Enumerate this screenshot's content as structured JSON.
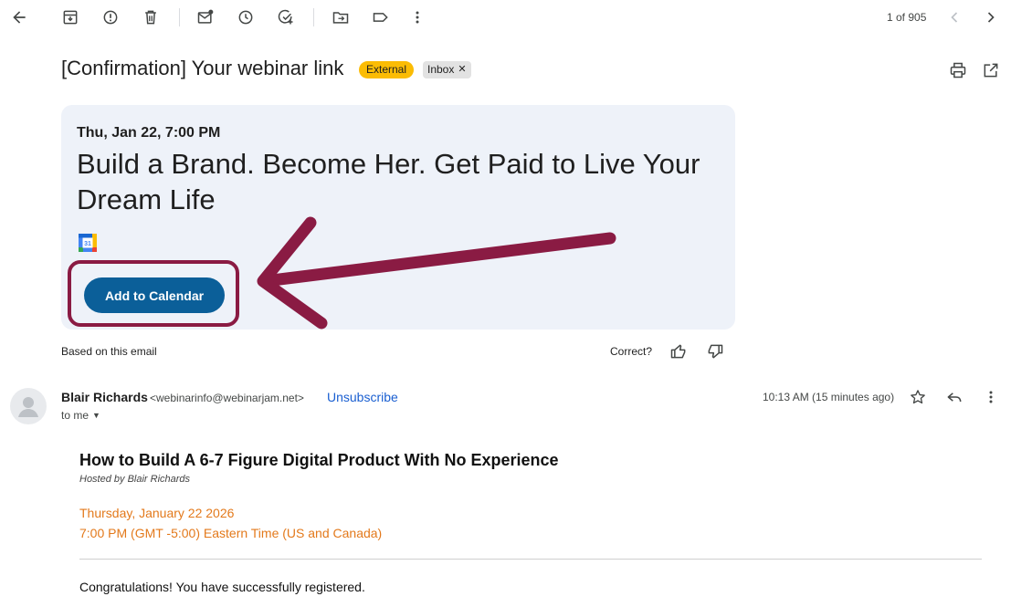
{
  "toolbar": {
    "icons": [
      "back-arrow-icon",
      "archive-icon",
      "report-spam-icon",
      "delete-icon",
      "mark-unread-icon",
      "snooze-icon",
      "add-to-tasks-icon",
      "move-to-icon",
      "label-icon",
      "more-vert-icon"
    ],
    "pagination": "1 of 905"
  },
  "email": {
    "subject": "[Confirmation] Your webinar link",
    "badges": {
      "external": "External",
      "inbox": "Inbox"
    }
  },
  "event_card": {
    "date": "Thu, Jan 22, 7:00 PM",
    "title": "Build a Brand. Become Her. Get Paid to Live Your Dream Life",
    "calendar_icon_label": "31",
    "add_button": "Add to Calendar",
    "based_on": "Based on this email",
    "correct_prompt": "Correct?"
  },
  "message": {
    "sender_name": "Blair Richards",
    "sender_email": "<webinarinfo@webinarjam.net>",
    "unsubscribe": "Unsubscribe",
    "to": "to me",
    "timestamp": "10:13 AM (15 minutes ago)"
  },
  "body": {
    "heading": "How to Build A 6-7 Figure Digital Product With No Experience",
    "hosted_by": "Hosted by Blair Richards",
    "date_line": "Thursday, January 22 2026",
    "time_line": "7:00 PM (GMT -5:00) Eastern Time (US and Canada)",
    "congrats": "Congratulations! You have successfully registered."
  },
  "colors": {
    "annotation": "#8a1b43",
    "button": "#0b5f99",
    "external_badge": "#fbbc04",
    "card_bg": "#eef2f9",
    "event_time_text": "#e3791b",
    "link": "#1a5fd1"
  }
}
